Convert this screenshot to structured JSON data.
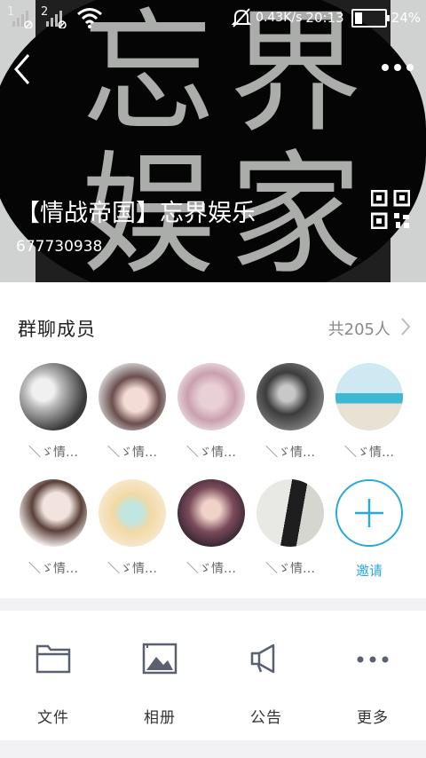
{
  "status_bar": {
    "sim1": "1",
    "sim2": "2",
    "network_speed": "0.43K/s",
    "time": "20:13",
    "battery": "24%",
    "battery_level": 0.24
  },
  "header": {
    "calligraphy": [
      "忘",
      "界",
      "娱",
      "家"
    ],
    "group_name": "【情战帝国】忘界娱乐",
    "group_id": "677730938"
  },
  "members": {
    "title": "群聊成员",
    "count": "共205人",
    "items": [
      {
        "name": "＼ゞ情…"
      },
      {
        "name": "＼ゞ情…"
      },
      {
        "name": "＼ゞ情…"
      },
      {
        "name": "＼ゞ情…"
      },
      {
        "name": "＼ゞ情…"
      },
      {
        "name": "＼ゞ情…"
      },
      {
        "name": "＼ゞ情…"
      },
      {
        "name": "＼ゞ情…"
      },
      {
        "name": "＼ゞ情…"
      }
    ],
    "invite_label": "邀请"
  },
  "actions": [
    {
      "label": "文件",
      "icon": "folder-icon"
    },
    {
      "label": "相册",
      "icon": "album-icon"
    },
    {
      "label": "公告",
      "icon": "megaphone-icon"
    },
    {
      "label": "更多",
      "icon": "more-icon"
    }
  ],
  "colors": {
    "accent": "#2aa8e0",
    "header_bg": "#050505",
    "page_bg": "#f2f2f4"
  }
}
